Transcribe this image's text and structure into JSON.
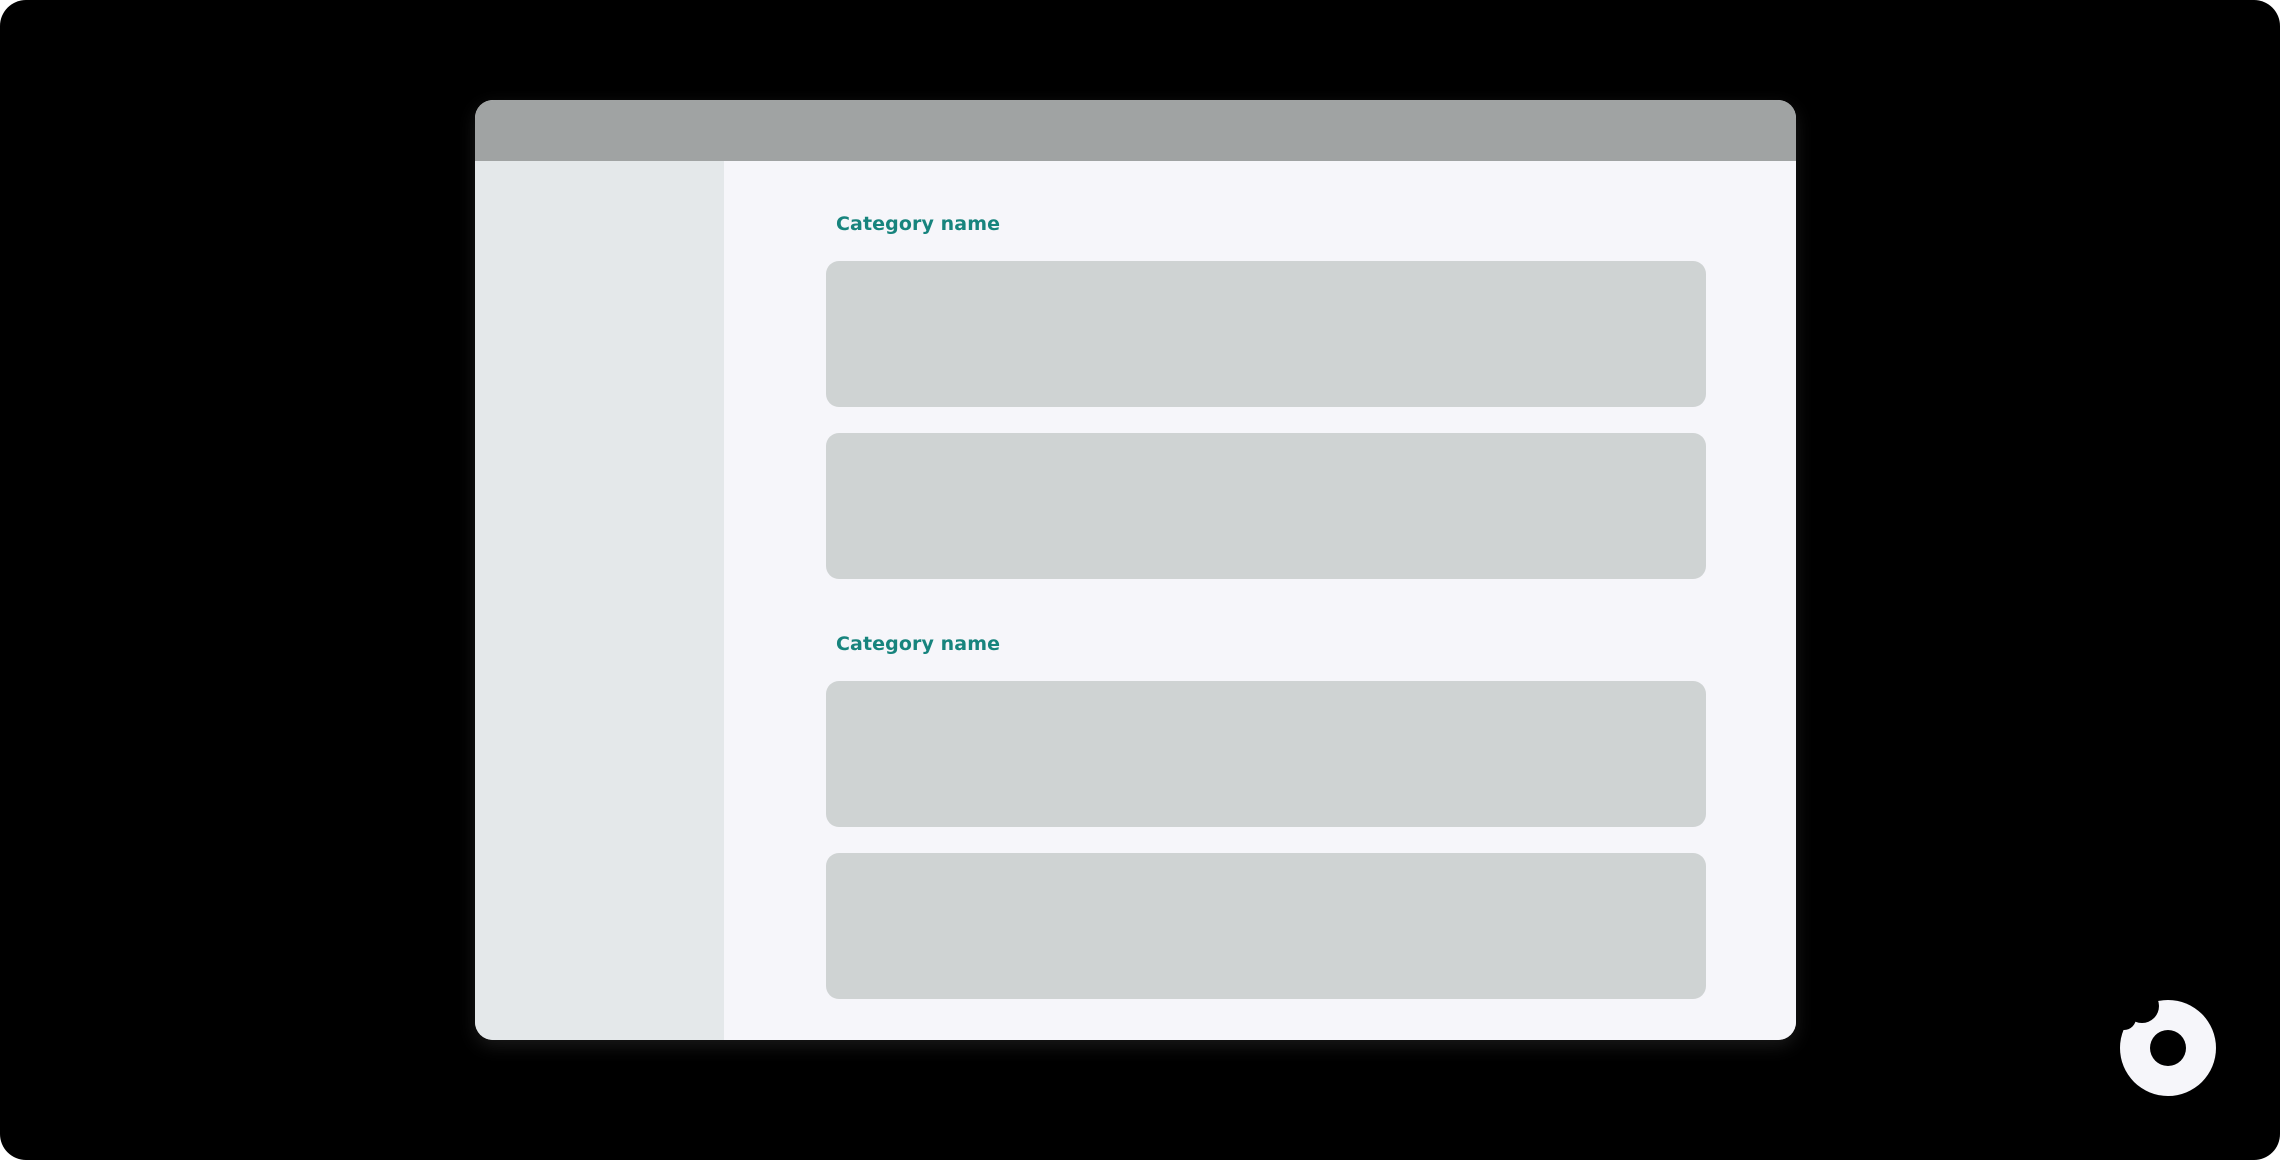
{
  "sections": [
    {
      "title": "Category name",
      "cards": 2
    },
    {
      "title": "Category name",
      "cards": 2
    }
  ],
  "logo": {
    "icon": "donut-bite-logo-icon",
    "color": "#f6f6fa"
  },
  "colors": {
    "background": "#000000",
    "titlebar": "#a0a3a3",
    "sidebar": "#e4e8ea",
    "content": "#f6f6fa",
    "card": "#cfd3d3",
    "accent": "#17847d"
  }
}
